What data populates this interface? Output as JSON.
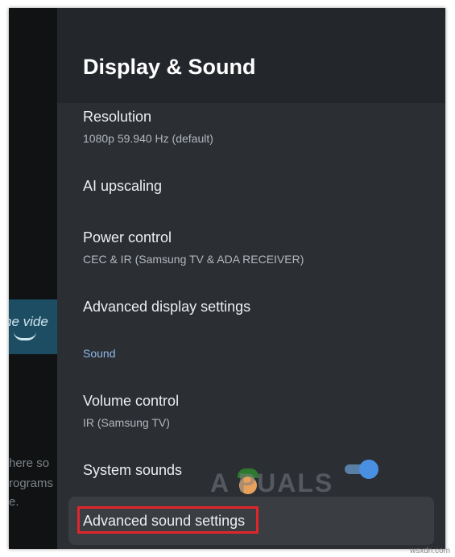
{
  "background": {
    "tile_text": "ne vide",
    "lines": [
      "here so",
      "rograms",
      "e."
    ]
  },
  "panel": {
    "title": "Display & Sound",
    "items": [
      {
        "title": "Resolution",
        "subtitle": "1080p 59.940 Hz (default)"
      },
      {
        "title": "AI upscaling"
      },
      {
        "title": "Power control",
        "subtitle": "CEC & IR (Samsung TV & ADA RECEIVER)"
      },
      {
        "title": "Advanced display settings"
      }
    ],
    "section_sound": "Sound",
    "sound_items": [
      {
        "title": "Volume control",
        "subtitle": "IR (Samsung TV)"
      },
      {
        "title": "System sounds",
        "toggle_on": true
      },
      {
        "title": "Advanced sound settings"
      }
    ]
  },
  "watermark": "A PUALS",
  "credit": "wsxdn.com",
  "colors": {
    "panel_bg": "#2b2e33",
    "accent_blue": "#4a90e2",
    "section_header": "#8fb8ea",
    "highlight_red": "#e0262c"
  }
}
